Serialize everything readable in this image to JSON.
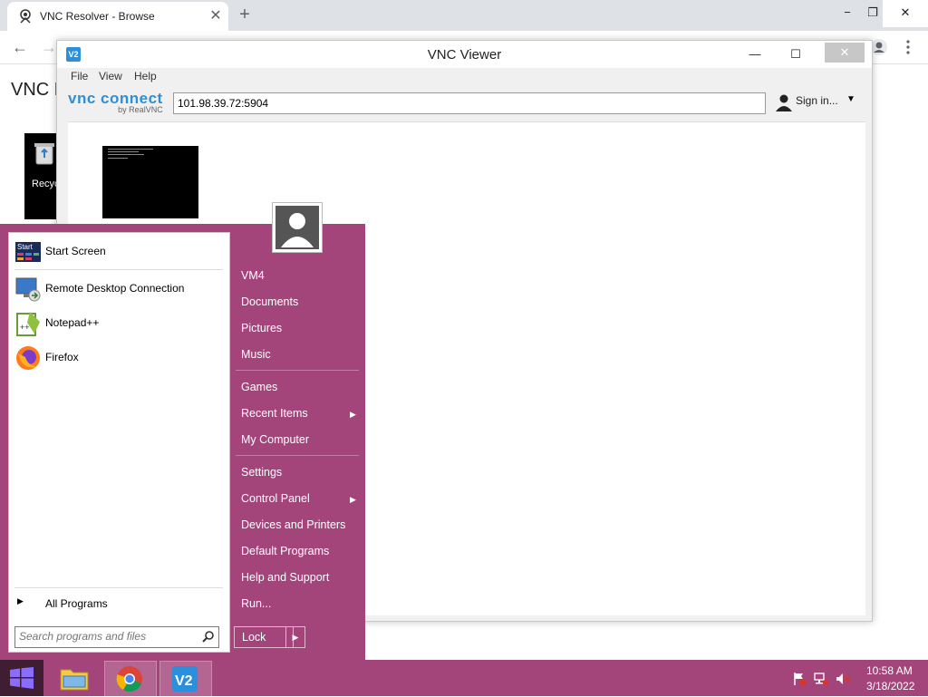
{
  "browser": {
    "tab_title": "VNC Resolver - Browse",
    "page_heading_partial": "VNC F",
    "desktop_icon_label": "Recyc",
    "minimize": "−",
    "restore": "❐",
    "close": "✕",
    "new_tab": "+",
    "back": "←",
    "forward": "→"
  },
  "vnc": {
    "title": "VNC Viewer",
    "menu": [
      "File",
      "View",
      "Help"
    ],
    "brand_main": "vnc connect",
    "brand_sub": "by RealVNC",
    "address": "101.98.39.72:5904",
    "sign_in": "Sign in...",
    "minimize": "—",
    "maximize": "☐",
    "close": "✕"
  },
  "start_menu": {
    "pinned": [
      {
        "label": "Start Screen",
        "icon": "start-screen-icon"
      },
      {
        "label": "Remote Desktop Connection",
        "icon": "remote-desktop-icon"
      },
      {
        "label": "Notepad++",
        "icon": "notepad-plus-plus-icon"
      },
      {
        "label": "Firefox",
        "icon": "firefox-icon"
      }
    ],
    "all_programs": "All Programs",
    "search_placeholder": "Search programs and files",
    "right_items": [
      {
        "label": "VM4"
      },
      {
        "label": "Documents"
      },
      {
        "label": "Pictures"
      },
      {
        "label": "Music"
      },
      {
        "label": "Games"
      },
      {
        "label": "Recent Items",
        "submenu": true
      },
      {
        "label": "My Computer"
      },
      {
        "label": "Settings"
      },
      {
        "label": "Control Panel",
        "submenu": true
      },
      {
        "label": "Devices and Printers"
      },
      {
        "label": "Default Programs"
      },
      {
        "label": "Help and Support"
      },
      {
        "label": "Run..."
      }
    ],
    "lock": "Lock",
    "accent_color": "#a3457b"
  },
  "taskbar": {
    "time": "10:58 AM",
    "date": "3/18/2022",
    "apps": [
      "file-explorer-icon",
      "chrome-icon",
      "vnc-viewer-icon"
    ]
  }
}
